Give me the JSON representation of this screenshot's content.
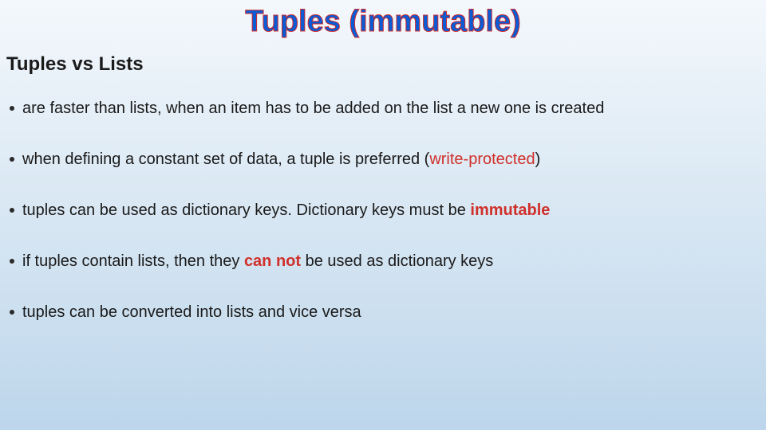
{
  "title": "Tuples (immutable)",
  "subheading": "Tuples vs Lists",
  "bullets": {
    "b1": "are faster than lists, when an item has to be added on the list a new one is created",
    "b2_pre": "when defining a constant set of data, a tuple is preferred (",
    "b2_red": "write-protected",
    "b2_post": ")",
    "b3_pre": "tuples can be used as dictionary keys. Dictionary keys must be ",
    "b3_red_bold": "immutable",
    "b4_pre": "if tuples contain lists, then they ",
    "b4_red_bold": "can not",
    "b4_post": " be used as dictionary keys",
    "b5": "tuples can be converted into lists and vice versa"
  }
}
